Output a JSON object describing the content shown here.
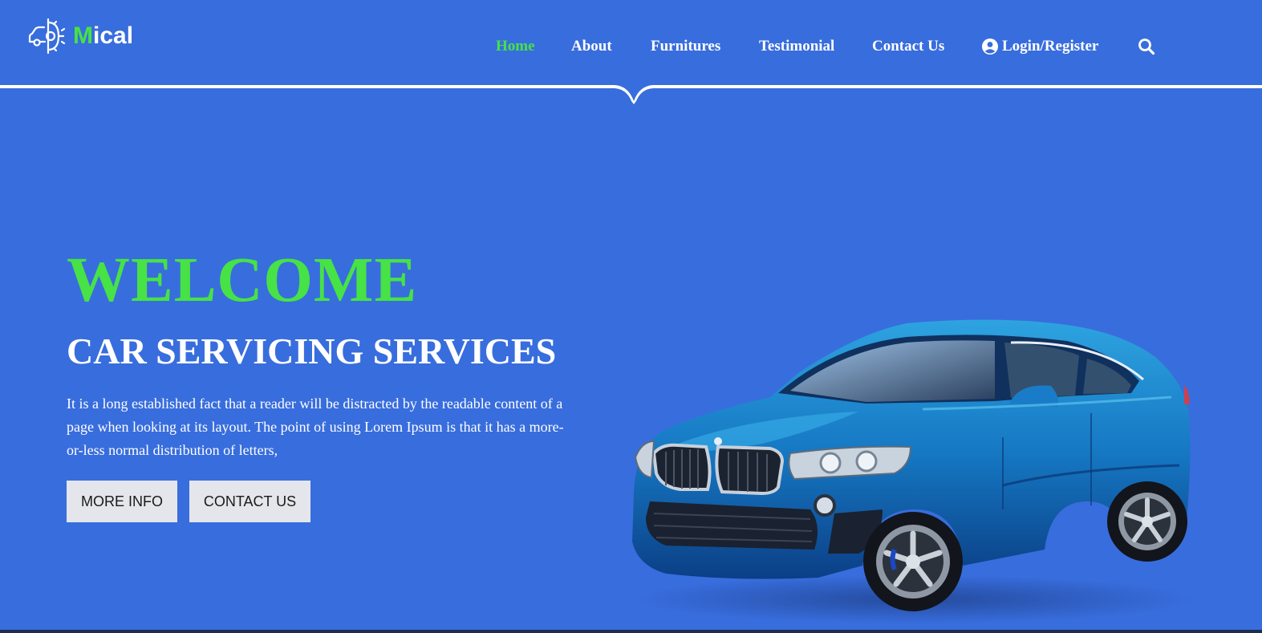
{
  "brand": {
    "name_accent": "M",
    "name_rest": "ical",
    "logo_icon": "car-gear-icon"
  },
  "nav": {
    "items": [
      {
        "label": "Home",
        "active": true
      },
      {
        "label": "About",
        "active": false
      },
      {
        "label": "Furnitures",
        "active": false
      },
      {
        "label": "Testimonial",
        "active": false
      },
      {
        "label": "Contact Us",
        "active": false
      }
    ],
    "login_label": "Login/Register",
    "login_icon": "user-circle-icon",
    "search_icon": "search-icon"
  },
  "hero": {
    "title": "WELCOME",
    "subtitle": "CAR SERVICING SERVICES",
    "text": "It is a long established fact that a reader will be distracted by the readable content of a page when looking at its layout. The point of using Lorem Ipsum is that it has a more-or-less normal distribution of letters,",
    "buttons": {
      "more_info": "MORE INFO",
      "contact_us": "CONTACT US"
    },
    "image": "blue-suv-car-image"
  },
  "colors": {
    "background": "#386ddd",
    "accent": "#47e246",
    "text": "#ffffff",
    "button_bg": "#e5e6eb"
  }
}
